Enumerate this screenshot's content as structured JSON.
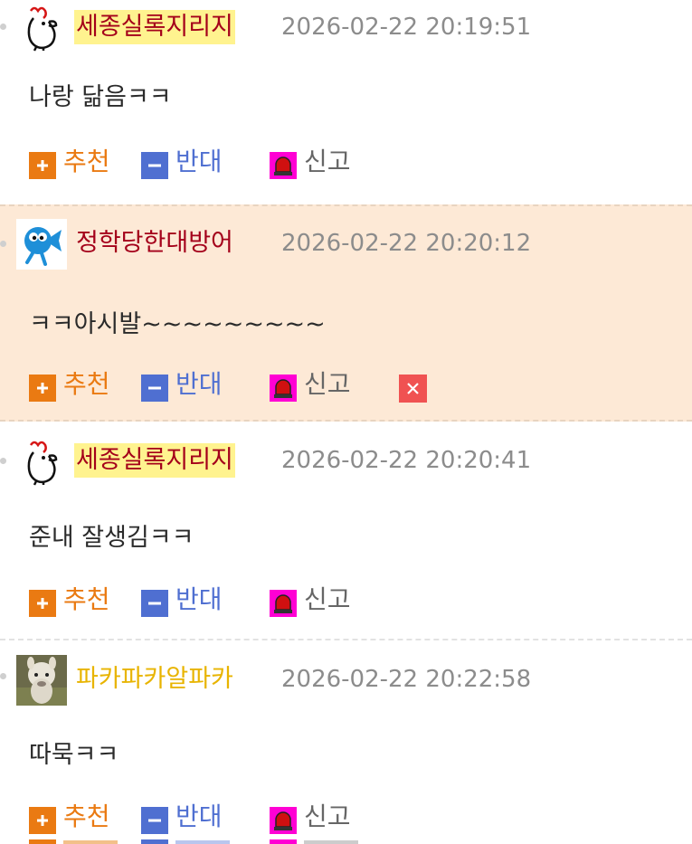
{
  "actions": {
    "upvote_label": "추천",
    "downvote_label": "반대",
    "report_label": "신고"
  },
  "colors": {
    "upvote": "#ea7a12",
    "downvote": "#4f6fd1",
    "report_icon_bg": "#ff00d4",
    "delete": "#f05252",
    "highlight_bg": "#fde9d6",
    "nick_highlight_bg": "#fff38f",
    "timestamp": "#8c8c8c"
  },
  "comments": [
    {
      "nickname": "세종실록지리지",
      "nick_color": "#a4001a",
      "timestamp": "2026-02-22 20:19:51",
      "text": "나랑 닮음ㅋㅋ",
      "avatar": "chicken-doodle-icon"
    },
    {
      "nickname": "정학당한대방어",
      "nick_color": "#a4001a",
      "timestamp": "2026-02-22 20:20:12",
      "text": "ㅋㅋ아시발~~~~~~~~~",
      "avatar": "blue-fish-icon"
    },
    {
      "nickname": "세종실록지리지",
      "nick_color": "#a4001a",
      "timestamp": "2026-02-22 20:20:41",
      "text": "준내 잘생김ㅋㅋ",
      "avatar": "chicken-doodle-icon"
    },
    {
      "nickname": "파카파카알파카",
      "nick_color": "#e8b400",
      "timestamp": "2026-02-22 20:22:58",
      "text": "따묵ㅋㅋ",
      "avatar": "alpaca-photo-icon"
    }
  ]
}
